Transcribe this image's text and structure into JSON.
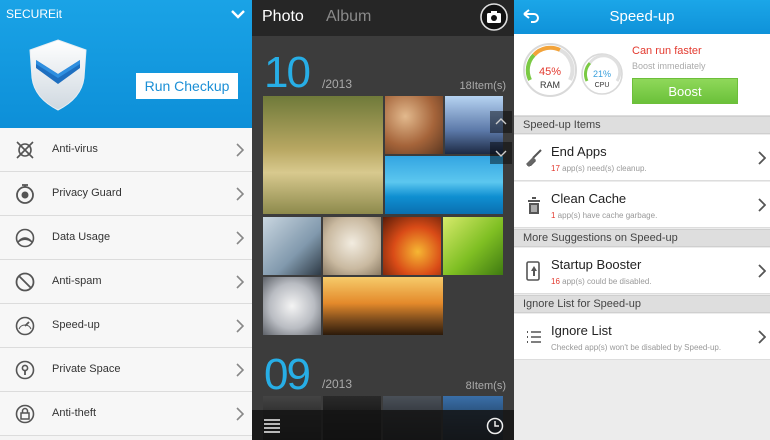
{
  "secureit": {
    "app_title": "SECUREit",
    "run_checkup_label": "Run Checkup",
    "menu": [
      {
        "label": "Anti-virus",
        "icon": "antivirus-icon"
      },
      {
        "label": "Privacy Guard",
        "icon": "privacy-guard-icon"
      },
      {
        "label": "Data Usage",
        "icon": "data-usage-icon"
      },
      {
        "label": "Anti-spam",
        "icon": "anti-spam-icon"
      },
      {
        "label": "Speed-up",
        "icon": "speedometer-icon"
      },
      {
        "label": "Private Space",
        "icon": "keyhole-icon"
      },
      {
        "label": "Anti-theft",
        "icon": "lock-icon"
      }
    ],
    "colors": {
      "header": "#1aa3e6",
      "button_text": "#1b8fd6"
    }
  },
  "gallery": {
    "tabs": {
      "photo": "Photo",
      "album": "Album"
    },
    "groups": [
      {
        "day": "10",
        "year": "/2013",
        "count": "18Item(s)"
      },
      {
        "day": "09",
        "year": "/2013",
        "count": "8Item(s)"
      }
    ],
    "accent": "#27aee6"
  },
  "speedup": {
    "title": "Speed-up",
    "gauges": {
      "ram": {
        "value": "45%",
        "label": "RAM",
        "fraction": 0.45
      },
      "cpu": {
        "value": "21%",
        "label": "CPU",
        "fraction": 0.21
      }
    },
    "status": "Can run faster",
    "status_sub": "Boost immediately",
    "boost_label": "Boost",
    "sections": {
      "items": "Speed-up Items",
      "more": "More Suggestions on Speed-up",
      "ignore": "Ignore List for Speed-up"
    },
    "end_apps": {
      "title": "End Apps",
      "num": "17",
      "sub": " app(s) need(s) cleanup."
    },
    "clean_cache": {
      "title": "Clean Cache",
      "num": "1",
      "sub": " app(s) have cache garbage."
    },
    "startup": {
      "title": "Startup Booster",
      "num": "16",
      "sub": " app(s) could be disabled."
    },
    "ignore_list": {
      "title": "Ignore List",
      "sub": "Checked app(s) won't be disabled by Speed-up."
    },
    "colors": {
      "header": "#1ba6e8",
      "alert": "#e33a2f",
      "boost": "#6bc13a"
    }
  }
}
